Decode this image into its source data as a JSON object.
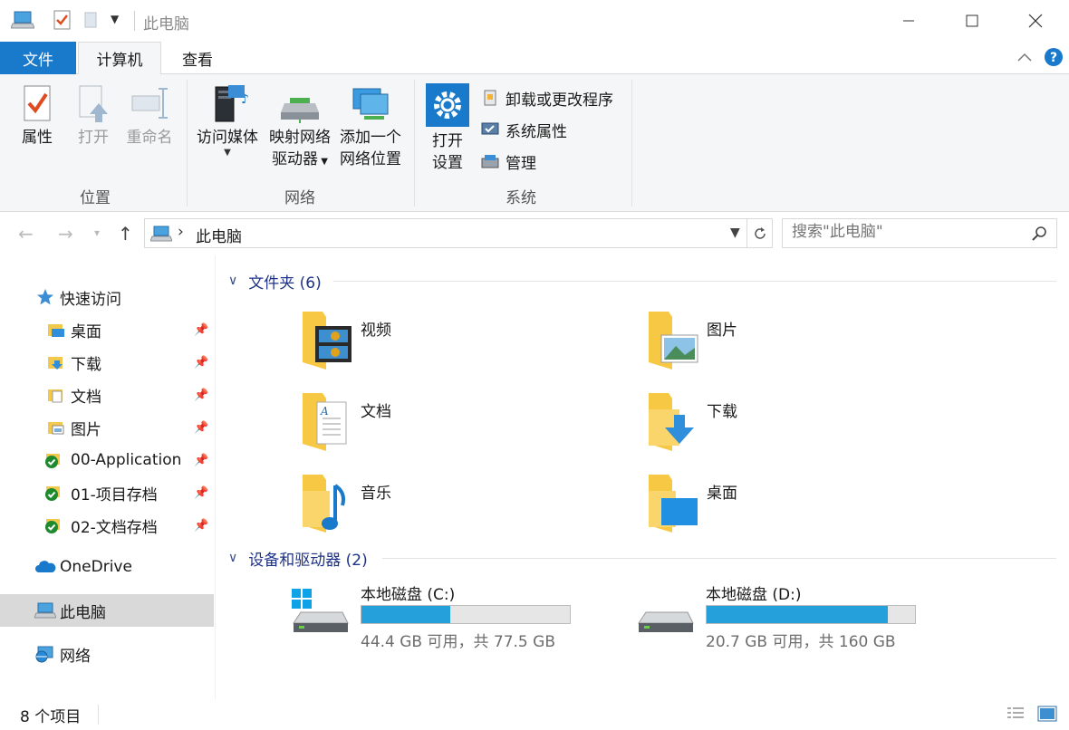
{
  "window": {
    "title": "此电脑",
    "minimize_icon": "minimize-icon",
    "maximize_icon": "maximize-icon",
    "close_icon": "close-icon"
  },
  "tabs": {
    "file": "文件",
    "computer": "计算机",
    "view": "查看"
  },
  "ribbon": {
    "location_group": {
      "label": "位置",
      "properties": "属性",
      "open": "打开",
      "rename": "重命名"
    },
    "network_group": {
      "label": "网络",
      "access_media": "访问媒体",
      "map_drive_line1": "映射网络",
      "map_drive_line2": "驱动器",
      "add_location_line1": "添加一个",
      "add_location_line2": "网络位置"
    },
    "system_group": {
      "label": "系统",
      "open_settings_line1": "打开",
      "open_settings_line2": "设置",
      "uninstall": "卸载或更改程序",
      "system_properties": "系统属性",
      "manage": "管理"
    }
  },
  "address": {
    "path": "此电脑",
    "search_placeholder": "搜索\"此电脑\""
  },
  "sidebar": {
    "quick_access": "快速访问",
    "items": [
      {
        "label": "桌面",
        "pinned": true
      },
      {
        "label": "下载",
        "pinned": true
      },
      {
        "label": "文档",
        "pinned": true
      },
      {
        "label": "图片",
        "pinned": true
      },
      {
        "label": "00-Application",
        "pinned": true
      },
      {
        "label": "01-项目存档",
        "pinned": true
      },
      {
        "label": "02-文档存档",
        "pinned": true
      }
    ],
    "onedrive": "OneDrive",
    "this_pc": "此电脑",
    "network": "网络"
  },
  "folders_section": {
    "title": "文件夹 (6)",
    "folders": [
      {
        "label": "视频",
        "icon": "video-folder-icon"
      },
      {
        "label": "图片",
        "icon": "pictures-folder-icon"
      },
      {
        "label": "文档",
        "icon": "documents-folder-icon"
      },
      {
        "label": "下载",
        "icon": "downloads-folder-icon"
      },
      {
        "label": "音乐",
        "icon": "music-folder-icon"
      },
      {
        "label": "桌面",
        "icon": "desktop-folder-icon"
      }
    ]
  },
  "drives_section": {
    "title": "设备和驱动器 (2)",
    "drives": [
      {
        "name": "本地磁盘 (C:)",
        "free_text": "44.4 GB 可用，共 77.5 GB",
        "used_fraction": 0.427
      },
      {
        "name": "本地磁盘 (D:)",
        "free_text": "20.7 GB 可用，共 160 GB",
        "used_fraction": 0.871
      }
    ]
  },
  "status": {
    "count": "8 个项目"
  },
  "colors": {
    "accent": "#1979ca",
    "drive_bar": "#26a0da",
    "section_title": "#1e3287",
    "selected_bg": "#d9d9d9"
  }
}
